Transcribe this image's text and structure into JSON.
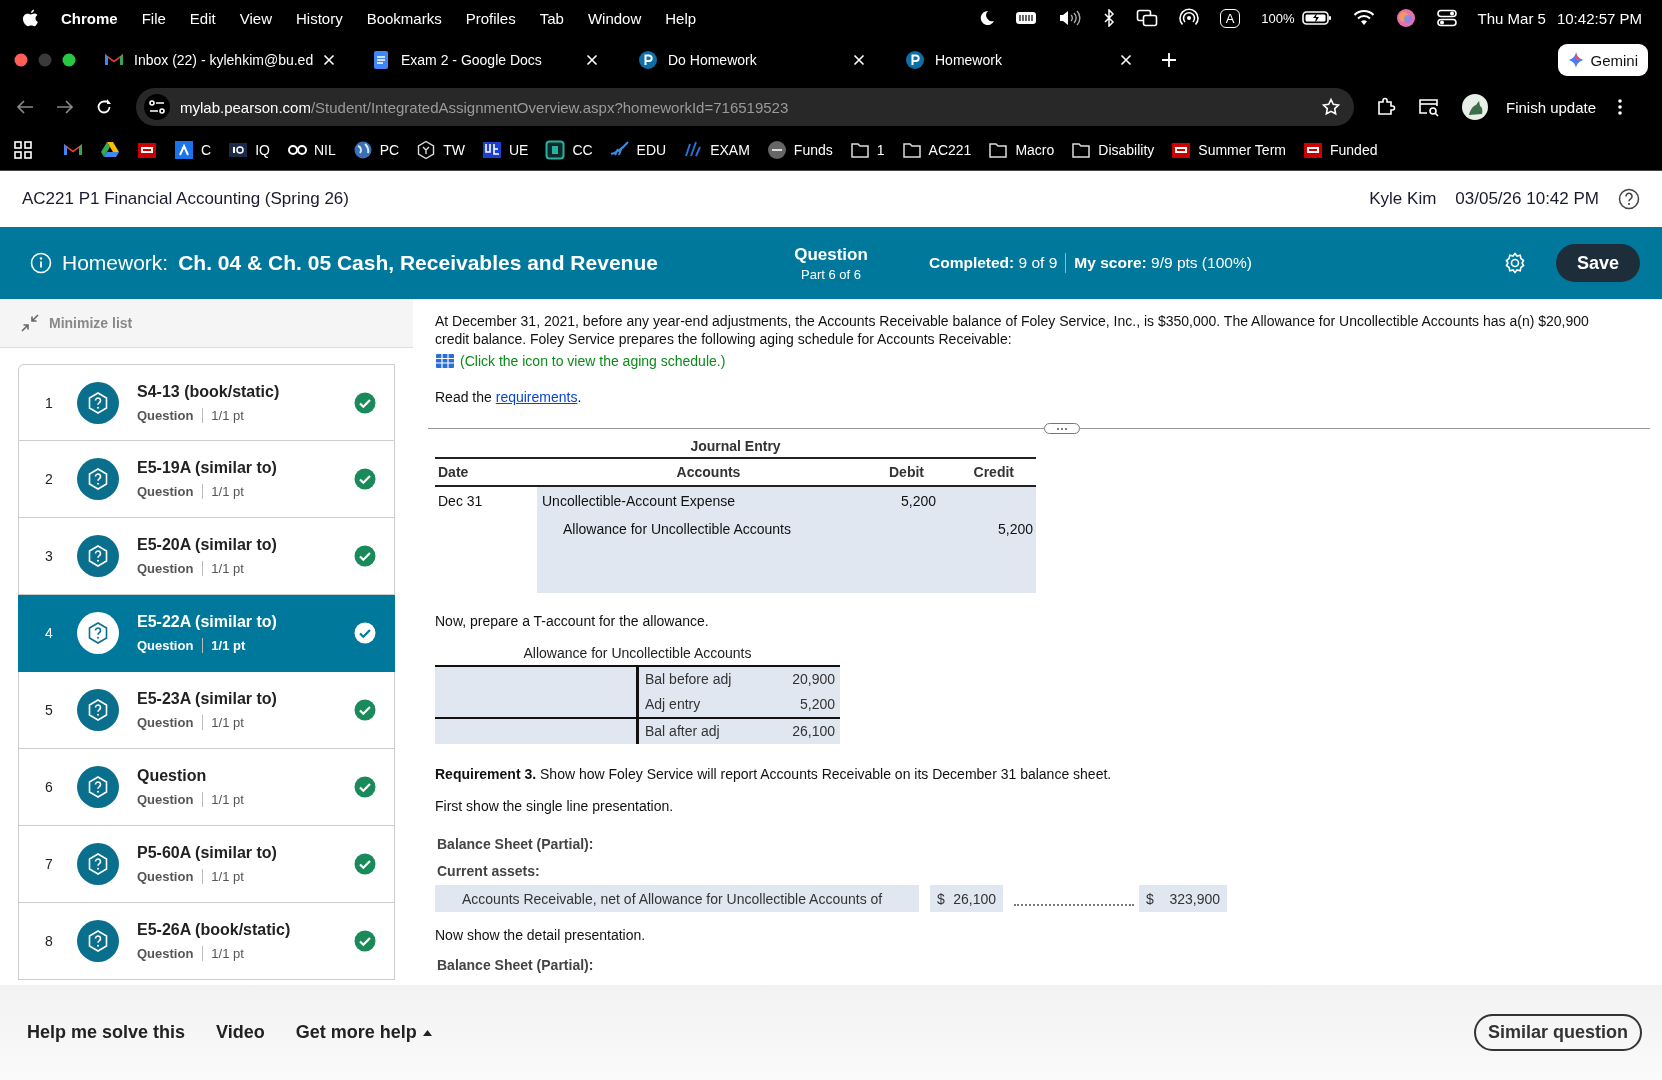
{
  "menu_bar": {
    "app": "Chrome",
    "menus": [
      "File",
      "Edit",
      "View",
      "History",
      "Bookmarks",
      "Profiles",
      "Tab",
      "Window",
      "Help"
    ],
    "input_source": "A",
    "battery": "100%",
    "date": "Thu Mar 5",
    "time": "10:42:57 PM"
  },
  "tabs": [
    {
      "title": "Inbox (22) - kylehkim@bu.ed",
      "kind": "mail"
    },
    {
      "title": "Exam 2 - Google Docs",
      "kind": "docs"
    },
    {
      "title": "Do Homework",
      "kind": "pearson"
    },
    {
      "title": "Homework",
      "kind": "pearson"
    }
  ],
  "gemini_button": "Gemini",
  "address": {
    "host": "mylab.pearson.com",
    "path": "/Student/IntegratedAssignmentOverview.aspx?homeworkId=716519523"
  },
  "update_button": "Finish update",
  "bookmarks": [
    {
      "kind": "mail"
    },
    {
      "kind": "drive"
    },
    {
      "kind": "bu"
    },
    {
      "kind": "a",
      "label": "C"
    },
    {
      "kind": "iq",
      "label": "IQ"
    },
    {
      "kind": "go",
      "label": "NIL"
    },
    {
      "kind": "globe",
      "label": "PC"
    },
    {
      "kind": "shield",
      "label": "TW"
    },
    {
      "kind": "ue",
      "label": "UE"
    },
    {
      "kind": "cc",
      "label": "CC"
    },
    {
      "kind": "edu",
      "label": "EDU"
    },
    {
      "kind": "exam",
      "label": "EXAM"
    },
    {
      "kind": "get",
      "label": "Funds"
    },
    {
      "kind": "folder",
      "label": "1"
    },
    {
      "kind": "folder",
      "label": "AC221"
    },
    {
      "kind": "folder",
      "label": "Macro"
    },
    {
      "kind": "folder",
      "label": "Disability"
    },
    {
      "kind": "bu",
      "label": "Summer Term"
    },
    {
      "kind": "bu",
      "label": "Funded"
    }
  ],
  "course": {
    "title": "AC221 P1 Financial Accounting (Spring 26)",
    "user": "Kyle Kim",
    "datetime": "03/05/26 10:42 PM"
  },
  "homework": {
    "label": "Homework:",
    "title": "Ch. 04 & Ch. 05 Cash, Receivables and Revenue",
    "question_label": "Question",
    "part": "Part 6 of 6",
    "completed_label": "Completed:",
    "completed": "9 of 9",
    "score_label": "My score:",
    "score": "9/9 pts (100%)",
    "save": "Save"
  },
  "sidebar": {
    "minimize": "Minimize list",
    "items": [
      {
        "number": "1",
        "title": "S4-13 (book/static)",
        "type": "Question",
        "points": "1/1 pt",
        "selected": false,
        "completed": true
      },
      {
        "number": "2",
        "title": "E5-19A (similar to)",
        "type": "Question",
        "points": "1/1 pt",
        "selected": false,
        "completed": true
      },
      {
        "number": "3",
        "title": "E5-20A (similar to)",
        "type": "Question",
        "points": "1/1 pt",
        "selected": false,
        "completed": true
      },
      {
        "number": "4",
        "title": "E5-22A (similar to)",
        "type": "Question",
        "points": "1/1 pt",
        "selected": true,
        "completed": true
      },
      {
        "number": "5",
        "title": "E5-23A (similar to)",
        "type": "Question",
        "points": "1/1 pt",
        "selected": false,
        "completed": true
      },
      {
        "number": "6",
        "title": "Question",
        "type": "Question",
        "points": "1/1 pt",
        "selected": false,
        "completed": true
      },
      {
        "number": "7",
        "title": "P5-60A (similar to)",
        "type": "Question",
        "points": "1/1 pt",
        "selected": false,
        "completed": true
      },
      {
        "number": "8",
        "title": "E5-26A (book/static)",
        "type": "Question",
        "points": "1/1 pt",
        "selected": false,
        "completed": true
      }
    ]
  },
  "question": {
    "intro": "At December 31, 2021, before any year-end adjustments, the Accounts Receivable balance of Foley Service, Inc., is $350,000. The Allowance for Uncollectible Accounts has a(n) $20,900 credit balance. Foley Service prepares the following aging schedule for Accounts Receivable:",
    "schedule_link": "(Click the icon to view the aging schedule.)",
    "read_prefix": "Read the ",
    "read_link": "requirements",
    "read_suffix": ".",
    "journal": {
      "title": "Journal Entry",
      "columns": [
        "Date",
        "Accounts",
        "Debit",
        "Credit"
      ],
      "rows": [
        {
          "kind": "debit",
          "date": "Dec 31",
          "account": "Uncollectible-Account Expense",
          "amount": "5,200"
        },
        {
          "kind": "credit",
          "account": "Allowance for Uncollectible Accounts",
          "amount": "5,200"
        }
      ]
    },
    "t_account_prompt": "Now, prepare a T-account for the allowance.",
    "t_account": {
      "title": "Allowance for Uncollectible Accounts",
      "credit_rows": [
        {
          "label": "Bal before adj",
          "amount": "20,900"
        },
        {
          "label": "Adj entry",
          "amount": "5,200"
        }
      ],
      "credit_total": {
        "label": "Bal after adj",
        "amount": "26,100"
      }
    },
    "requirement": "**Requirement 3.** Show how Foley Service will report Accounts Receivable on its December 31 balance sheet.",
    "single_prompt": "First show the single line presentation.",
    "balance_sheet": {
      "title": "Balance Sheet (Partial):",
      "section": "Current assets:",
      "line": "Accounts Receivable, net of Allowance for Uncollectible Accounts of",
      "allowance": {
        "currency": "$",
        "amount": "26,100"
      },
      "net": {
        "currency": "$",
        "amount": "323,900"
      }
    },
    "detail_prompt": "Now show the detail presentation.",
    "detail_title": "Balance Sheet (Partial):"
  },
  "help_bar": {
    "buttons": [
      "Help me solve this",
      "Video"
    ],
    "more": "Get more help",
    "similar": "Similar question"
  }
}
